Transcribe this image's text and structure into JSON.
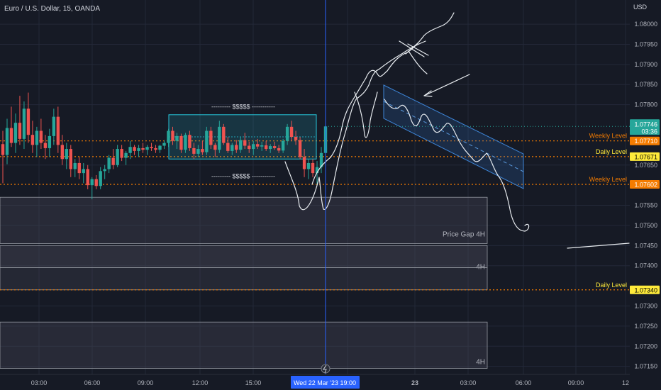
{
  "header": {
    "symbol_title": "Euro / U.S. Dollar, 15, OANDA",
    "currency": "USD"
  },
  "colors": {
    "background": "#161a25",
    "grid": "#232838",
    "up": "#26a69a",
    "down": "#ef5350",
    "level_line": "#f57c00",
    "crosshair": "#2962ff",
    "channel": "#2d6fc0",
    "gap_zone": "#4a4a58",
    "box": "#26c6da",
    "drawing": "#e8ecf0"
  },
  "chart_data": {
    "type": "candlestick",
    "y_axis": {
      "min": 1.0713,
      "max": 1.0806,
      "scale": "linear",
      "tick_labels": [
        "1.08000",
        "1.07950",
        "1.07900",
        "1.07850",
        "1.07800",
        "1.07650",
        "1.07550",
        "1.07500",
        "1.07450",
        "1.07400",
        "1.07300",
        "1.07250",
        "1.07200",
        "1.07150"
      ]
    },
    "x_axis": {
      "tick_labels": [
        "03:00",
        "06:00",
        "09:00",
        "12:00",
        "15:00",
        "19:00",
        "23",
        "03:00",
        "06:00",
        "09:00",
        "12"
      ],
      "crosshair_label": "Wed 22 Mar '23  19:00"
    },
    "current_price": {
      "value": "1.07746",
      "countdown": "03:36"
    },
    "levels": [
      {
        "name": "Weekly Level",
        "price": 1.0771,
        "price_label": "1.07710",
        "label_color": "#f57c00"
      },
      {
        "name": "Daily Level",
        "price": 1.07671,
        "price_label": "1.07671",
        "label_color": "#ffeb3b"
      },
      {
        "name": "Weekly Level",
        "price": 1.07602,
        "price_label": "1.07602",
        "label_color": "#f57c00"
      },
      {
        "name": "Daily Level",
        "price": 1.0734,
        "price_label": "1.07340",
        "label_color": "#ffeb3b"
      }
    ],
    "zones": [
      {
        "label": "Price Gap 4H",
        "top": 1.0757,
        "bottom": 1.07455
      },
      {
        "label": "4H",
        "top": 1.0745,
        "bottom": 1.07395
      },
      {
        "label": "4H",
        "top": 1.07395,
        "bottom": 1.0734
      },
      {
        "label": "4H",
        "top": 1.0726,
        "bottom": 1.07145
      }
    ],
    "annotations": [
      {
        "text": "--------- $$$$$ -----------",
        "near_price": 1.07795
      },
      {
        "text": "--------- $$$$$ -----------",
        "near_price": 1.07622
      }
    ],
    "consolidation_box": {
      "top": 1.07775,
      "bottom": 1.07665
    },
    "candles_ohlc": [
      [
        1.07702,
        1.07735,
        1.07605,
        1.07675
      ],
      [
        1.07675,
        1.07765,
        1.07652,
        1.07742
      ],
      [
        1.07742,
        1.07795,
        1.07695,
        1.07705
      ],
      [
        1.07705,
        1.07778,
        1.0768,
        1.07755
      ],
      [
        1.07755,
        1.07822,
        1.077,
        1.07715
      ],
      [
        1.07715,
        1.07808,
        1.0769,
        1.0779
      ],
      [
        1.0779,
        1.0783,
        1.07705,
        1.07725
      ],
      [
        1.07725,
        1.0776,
        1.0768,
        1.077
      ],
      [
        1.077,
        1.07745,
        1.0767,
        1.07735
      ],
      [
        1.07735,
        1.07765,
        1.0769,
        1.07705
      ],
      [
        1.07705,
        1.07725,
        1.07665,
        1.07692
      ],
      [
        1.07692,
        1.0774,
        1.0767,
        1.07722
      ],
      [
        1.07722,
        1.0779,
        1.077,
        1.0777
      ],
      [
        1.0777,
        1.07795,
        1.0768,
        1.077
      ],
      [
        1.077,
        1.07725,
        1.0765,
        1.07665
      ],
      [
        1.07665,
        1.07705,
        1.0764,
        1.0769
      ],
      [
        1.0769,
        1.077,
        1.0762,
        1.0764
      ],
      [
        1.0764,
        1.07665,
        1.0762,
        1.07655
      ],
      [
        1.07655,
        1.0767,
        1.07615,
        1.0763
      ],
      [
        1.0763,
        1.07655,
        1.07605,
        1.0764
      ],
      [
        1.0764,
        1.0765,
        1.0759,
        1.076
      ],
      [
        1.076,
        1.0762,
        1.07565,
        1.07615
      ],
      [
        1.07615,
        1.07625,
        1.0759,
        1.07598
      ],
      [
        1.07598,
        1.07645,
        1.0759,
        1.07635
      ],
      [
        1.07635,
        1.0765,
        1.07615,
        1.0764
      ],
      [
        1.0764,
        1.07675,
        1.0763,
        1.07668
      ],
      [
        1.07668,
        1.0769,
        1.0764,
        1.0765
      ],
      [
        1.0765,
        1.077,
        1.07645,
        1.0769
      ],
      [
        1.0769,
        1.077,
        1.0766,
        1.07668
      ],
      [
        1.07668,
        1.07685,
        1.0765,
        1.0768
      ],
      [
        1.0768,
        1.0771,
        1.07665,
        1.07695
      ],
      [
        1.07695,
        1.077,
        1.07675,
        1.07685
      ],
      [
        1.07685,
        1.077,
        1.0767,
        1.07692
      ],
      [
        1.07692,
        1.07705,
        1.0768,
        1.07688
      ],
      [
        1.07688,
        1.077,
        1.07675,
        1.07695
      ],
      [
        1.07695,
        1.07705,
        1.07685,
        1.07692
      ],
      [
        1.07692,
        1.077,
        1.0768,
        1.07688
      ],
      [
        1.07688,
        1.077,
        1.0768,
        1.07698
      ],
      [
        1.07698,
        1.07712,
        1.0769,
        1.07705
      ],
      [
        1.07705,
        1.0774,
        1.07695,
        1.07735
      ],
      [
        1.07735,
        1.07745,
        1.077,
        1.0771
      ],
      [
        1.0771,
        1.0773,
        1.0769,
        1.07722
      ],
      [
        1.07722,
        1.07728,
        1.0768,
        1.07688
      ],
      [
        1.07688,
        1.0773,
        1.0768,
        1.07725
      ],
      [
        1.07725,
        1.07735,
        1.07685,
        1.07692
      ],
      [
        1.07692,
        1.07705,
        1.07665,
        1.07678
      ],
      [
        1.07678,
        1.077,
        1.0767,
        1.0769
      ],
      [
        1.0769,
        1.0771,
        1.07675,
        1.07682
      ],
      [
        1.07682,
        1.07745,
        1.07675,
        1.07735
      ],
      [
        1.07735,
        1.07745,
        1.0769,
        1.077
      ],
      [
        1.077,
        1.07705,
        1.0767,
        1.07688
      ],
      [
        1.07688,
        1.0776,
        1.0768,
        1.07745
      ],
      [
        1.07745,
        1.07752,
        1.077,
        1.07705
      ],
      [
        1.07705,
        1.0772,
        1.0768,
        1.07685
      ],
      [
        1.07685,
        1.07705,
        1.07675,
        1.077
      ],
      [
        1.077,
        1.07712,
        1.0768,
        1.07688
      ],
      [
        1.07688,
        1.0772,
        1.0768,
        1.07712
      ],
      [
        1.07712,
        1.0773,
        1.0769,
        1.07698
      ],
      [
        1.07698,
        1.07708,
        1.0768,
        1.0769
      ],
      [
        1.0769,
        1.0771,
        1.07675,
        1.07702
      ],
      [
        1.07702,
        1.07715,
        1.0769,
        1.07696
      ],
      [
        1.07696,
        1.07708,
        1.07685,
        1.07699
      ],
      [
        1.07699,
        1.0771,
        1.07685,
        1.0769
      ],
      [
        1.0769,
        1.07702,
        1.0768,
        1.07697
      ],
      [
        1.07697,
        1.07708,
        1.07688,
        1.07692
      ],
      [
        1.07692,
        1.077,
        1.0768,
        1.07686
      ],
      [
        1.07686,
        1.07715,
        1.0768,
        1.0771
      ],
      [
        1.0771,
        1.07752,
        1.077,
        1.07745
      ],
      [
        1.07745,
        1.0776,
        1.0771,
        1.0772
      ],
      [
        1.0772,
        1.07735,
        1.077,
        1.07712
      ],
      [
        1.07712,
        1.0772,
        1.07665,
        1.0767
      ],
      [
        1.0767,
        1.0769,
        1.0762,
        1.0764
      ],
      [
        1.0764,
        1.07665,
        1.07615,
        1.07655
      ],
      [
        1.07655,
        1.07665,
        1.0762,
        1.0763
      ],
      [
        1.0763,
        1.0766,
        1.076,
        1.07645
      ],
      [
        1.07645,
        1.07695,
        1.0763,
        1.0768
      ],
      [
        1.0768,
        1.0776,
        1.07675,
        1.07746
      ]
    ]
  }
}
